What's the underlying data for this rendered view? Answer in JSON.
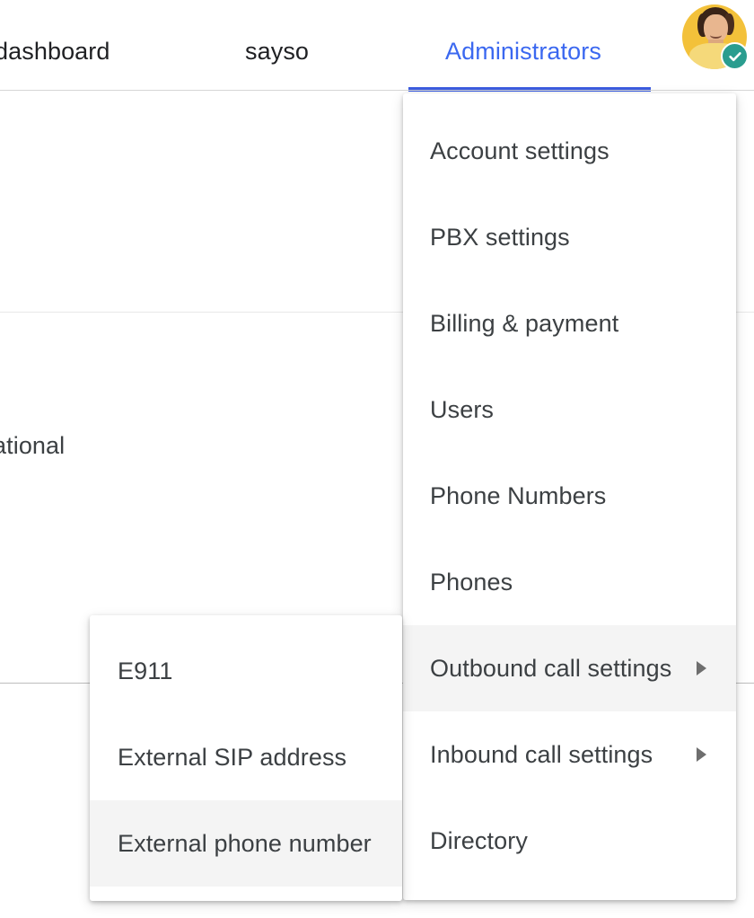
{
  "topnav": {
    "items": [
      {
        "label": "dashboard",
        "active": false
      },
      {
        "label": "sayso",
        "active": false
      },
      {
        "label": "Administrators",
        "active": true
      }
    ],
    "active_color": "#3b68f0",
    "underline_color": "#3b5ce0"
  },
  "avatar": {
    "name": "user-avatar",
    "badge_icon": "check-icon",
    "badge_color": "#2a9d8f",
    "background_color": "#f3c13a"
  },
  "background": {
    "partial_text": "ational"
  },
  "admin_menu": {
    "items": [
      {
        "label": "Account settings",
        "has_submenu": false,
        "highlight": false
      },
      {
        "label": "PBX settings",
        "has_submenu": false,
        "highlight": false
      },
      {
        "label": "Billing & payment",
        "has_submenu": false,
        "highlight": false
      },
      {
        "label": "Users",
        "has_submenu": false,
        "highlight": false
      },
      {
        "label": "Phone Numbers",
        "has_submenu": false,
        "highlight": false
      },
      {
        "label": "Phones",
        "has_submenu": false,
        "highlight": false
      },
      {
        "label": "Outbound call settings",
        "has_submenu": true,
        "highlight": true
      },
      {
        "label": "Inbound call settings",
        "has_submenu": true,
        "highlight": false
      },
      {
        "label": "Directory",
        "has_submenu": false,
        "highlight": false
      }
    ],
    "submenu_arrow_icon": "chevron-right-icon",
    "highlight_color": "#f4f4f4"
  },
  "outbound_submenu": {
    "items": [
      {
        "label": "E911",
        "highlight": false
      },
      {
        "label": "External SIP address",
        "highlight": false
      },
      {
        "label": "External phone number",
        "highlight": true
      }
    ],
    "highlight_color": "#f4f4f4"
  }
}
